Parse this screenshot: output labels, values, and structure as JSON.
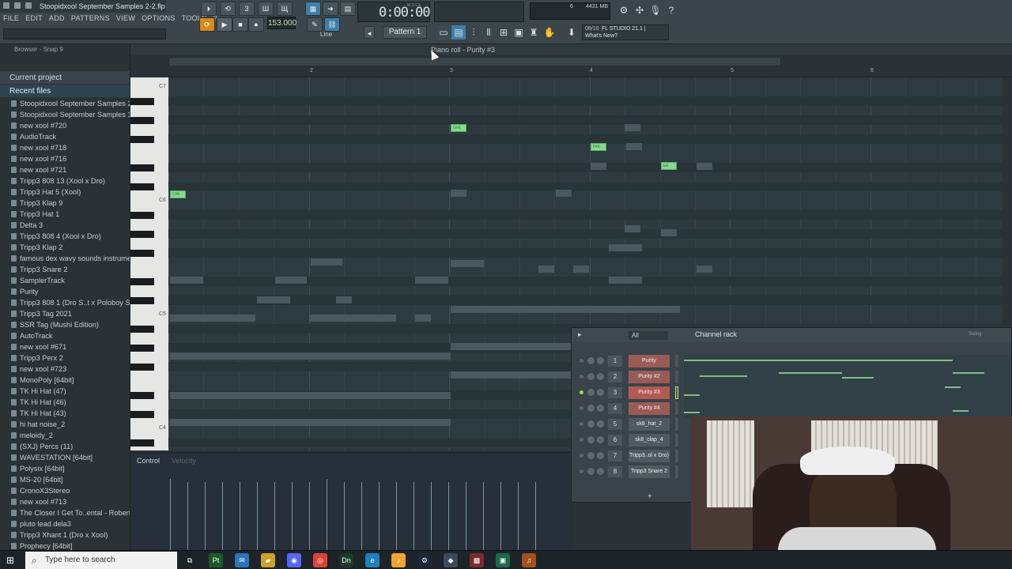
{
  "window": {
    "title": "Stoopidxool September Samples 2-2.flp"
  },
  "menu": [
    "FILE",
    "EDIT",
    "ADD",
    "PATTERNS",
    "VIEW",
    "OPTIONS",
    "TOOLS",
    "?"
  ],
  "transport": {
    "tempo": "153.000",
    "time": "0:00:00",
    "time_unit": "M:S:CS",
    "pattern": "Pattern 1",
    "snap_mode": "Line",
    "cpu": "6",
    "memory": "4431 MB",
    "play_icon": "play-icon",
    "stop_icon": "stop-icon",
    "record_icon": "record-icon"
  },
  "news": {
    "date": "08/10",
    "title": "FL STUDIO 21.1 |",
    "link": "What's New?"
  },
  "browser": {
    "header": "Browser - Snap 9",
    "sections": [
      "Current project",
      "Recent files"
    ],
    "files": [
      "Stoopidxool September Samples 2-2",
      "Stoopidxool September Samples 1-2",
      "new xool #720",
      "AudioTrack",
      "new xool #718",
      "new xool #716",
      "new xool #721",
      "Tripp3 808 13 (Xool x Dro)",
      "Tripp3 Hat 5 (Xool)",
      "Tripp3 Klap 9",
      "Tripp3 Hat 1",
      "Delta 3",
      "Tripp3 808 4 (Xool x Dro)",
      "Tripp3 Klap 2",
      "famous dex wavy sounds instrumental",
      "Tripp3 Snare 2",
      "SamplerTrack",
      "Purity",
      "Tripp3 808 1 (Dro S..t x Poloboy Shawty)",
      "Tripp3 Tag 2021",
      "SSR Tag (Mushi Edition)",
      "AutoTrack",
      "new xool #671",
      "Tripp3 Perx 2",
      "new xool #723",
      "MonoPoly [64bit]",
      "TK Hi Hat (47)",
      "TK Hi Hat (46)",
      "TK Hi Hat (43)",
      "hi hat noise_2",
      "meloidy_2",
      "(SXJ) Percs (11)",
      "WAVESTATION [64bit]",
      "Polysix [64bit]",
      "MS-20 [64bit]",
      "CronoX3Stereo",
      "new xool #713",
      "The Closer I Get To..ental - Roberta Flack",
      "pluto lead dela3",
      "Tripp3 Xhant 1 (Dro x Xool)",
      "Prophecy [64bit]"
    ]
  },
  "piano_roll": {
    "title": "Piano roll - Purity #3",
    "bars": [
      "2",
      "3",
      "4",
      "5",
      "6"
    ],
    "key_labels": [
      "C7",
      "C6",
      "C5",
      "C4"
    ],
    "note_labels": [
      "G#6",
      "F#6",
      "E6",
      "C#6"
    ],
    "control_label": "Control",
    "control_param": "Velocity"
  },
  "channel_rack": {
    "title": "Channel rack",
    "filter": "All",
    "swing_label": "Swing",
    "add_label": "+",
    "channels": [
      {
        "num": "1",
        "name": "Purity"
      },
      {
        "num": "2",
        "name": "Purity #2"
      },
      {
        "num": "3",
        "name": "Purity #3"
      },
      {
        "num": "4",
        "name": "Purity #4"
      },
      {
        "num": "5",
        "name": "sk8_hat_2"
      },
      {
        "num": "6",
        "name": "sk8_clap_4"
      },
      {
        "num": "7",
        "name": "Tripp3..ol x Dro)"
      },
      {
        "num": "8",
        "name": "Tripp3 Snare 2"
      }
    ]
  },
  "taskbar": {
    "search_placeholder": "Type here to search"
  }
}
